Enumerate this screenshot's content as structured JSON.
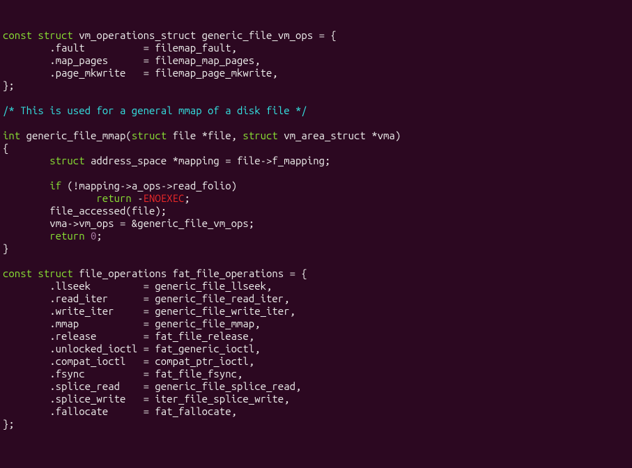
{
  "line1": {
    "kw1": "const",
    "kw2": "struct",
    "rest": " vm_operations_struct generic_file_vm_ops = {"
  },
  "line2": "        .fault          = filemap_fault,",
  "line3": "        .map_pages      = filemap_map_pages,",
  "line4": "        .page_mkwrite   = filemap_page_mkwrite,",
  "line5": "};",
  "line6": "",
  "line7": {
    "cmt": "/* This is used for a general mmap of a disk file */"
  },
  "line8": "",
  "line9": {
    "kw1": "int",
    "t1": " generic_file_mmap(",
    "kw2": "struct",
    "t2": " file *file, ",
    "kw3": "struct",
    "t3": " vm_area_struct *vma)"
  },
  "line10": "{",
  "line11": {
    "pad": "        ",
    "kw": "struct",
    "rest": " address_space *mapping = file->f_mapping;"
  },
  "line12": "",
  "line13": {
    "pad": "        ",
    "kw": "if",
    "rest": " (!mapping->a_ops->read_folio)"
  },
  "line14": {
    "pad": "                ",
    "kw": "return",
    "t1": " -",
    "err": "ENOEXEC",
    "t2": ";"
  },
  "line15": "        file_accessed(file);",
  "line16": "        vma->vm_ops = &generic_file_vm_ops;",
  "line17": {
    "pad": "        ",
    "kw": "return",
    "sp": " ",
    "num": "0",
    "t": ";"
  },
  "line18": "}",
  "line19": "",
  "line20": {
    "kw1": "const",
    "kw2": "struct",
    "rest": " file_operations fat_file_operations = {"
  },
  "line21": "        .llseek         = generic_file_llseek,",
  "line22": "        .read_iter      = generic_file_read_iter,",
  "line23": "        .write_iter     = generic_file_write_iter,",
  "line24": "        .mmap           = generic_file_mmap,",
  "line25": "        .release        = fat_file_release,",
  "line26": "        .unlocked_ioctl = fat_generic_ioctl,",
  "line27": "        .compat_ioctl   = compat_ptr_ioctl,",
  "line28": "        .fsync          = fat_file_fsync,",
  "line29": "        .splice_read    = generic_file_splice_read,",
  "line30": "        .splice_write   = iter_file_splice_write,",
  "line31": "        .fallocate      = fat_fallocate,",
  "line32": "};"
}
